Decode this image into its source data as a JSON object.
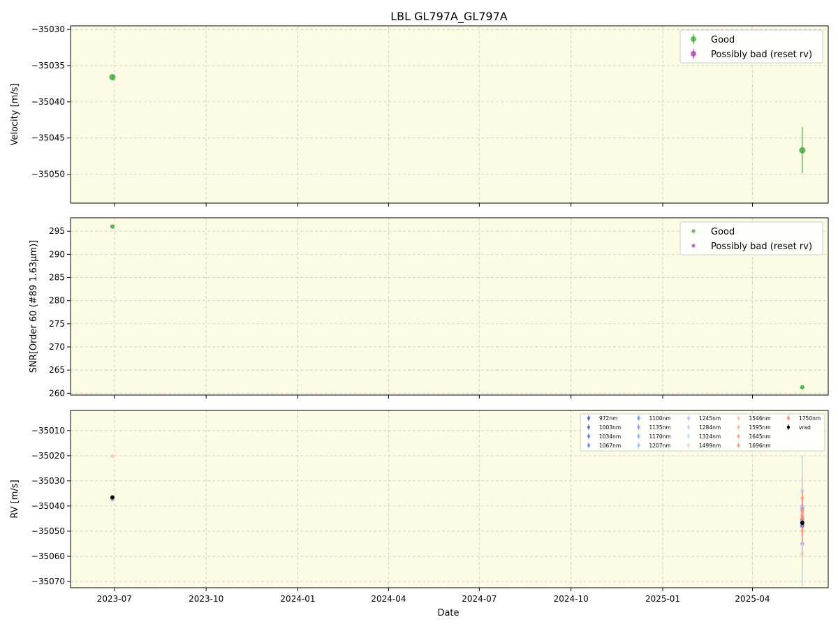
{
  "figure": {
    "title": "LBL GL797A_GL797A"
  },
  "chart_data": [
    {
      "type": "scatter",
      "panel": "velocity",
      "ylabel": "Velocity [m/s]",
      "xlabel": "",
      "xlim": [
        "2023-05-18",
        "2025-06-16"
      ],
      "ylim": [
        -35054,
        -35029.5
      ],
      "yticks": [
        -35030,
        -35035,
        -35040,
        -35045,
        -35050
      ],
      "ytick_labels": [
        "−35030",
        "−35035",
        "−35040",
        "−35045",
        "−35050"
      ],
      "grid": true,
      "legend_position": "top-right",
      "series": [
        {
          "name": "Good",
          "color": "#2ca02c",
          "marker": "errorbar",
          "points": [
            {
              "x": "2023-06-29",
              "y": -35036.6,
              "err": 0.3
            },
            {
              "x": "2025-05-21",
              "y": -35046.7,
              "err": 3.2
            }
          ]
        },
        {
          "name": "Possibly bad (reset rv)",
          "color": "#9b2f9b",
          "marker": "errorbar",
          "points": []
        }
      ]
    },
    {
      "type": "scatter",
      "panel": "snr",
      "ylabel": "SNR[Order 60 (#89 1.63µm)]",
      "xlabel": "",
      "xlim": [
        "2023-05-18",
        "2025-06-16"
      ],
      "ylim": [
        259.6,
        297.9
      ],
      "yticks": [
        295,
        290,
        285,
        280,
        275,
        270,
        265,
        260
      ],
      "ytick_labels": [
        "295",
        "290",
        "285",
        "280",
        "275",
        "270",
        "265",
        "260"
      ],
      "grid": true,
      "legend_position": "top-right",
      "series": [
        {
          "name": "Good",
          "color": "#2ca02c",
          "marker": "dot",
          "points": [
            {
              "x": "2023-06-29",
              "y": 296.0
            },
            {
              "x": "2025-05-21",
              "y": 261.3
            }
          ]
        },
        {
          "name": "Possibly bad (reset rv)",
          "color": "#9b2f9b",
          "marker": "dot",
          "points": []
        }
      ]
    },
    {
      "type": "scatter",
      "panel": "rv",
      "ylabel": "RV [m/s]",
      "xlabel": "Date",
      "xlim": [
        "2023-05-18",
        "2025-06-16"
      ],
      "ylim": [
        -35072.5,
        -35002
      ],
      "yticks": [
        -35010,
        -35020,
        -35030,
        -35040,
        -35050,
        -35060,
        -35070
      ],
      "ytick_labels": [
        "−35010",
        "−35020",
        "−35030",
        "−35040",
        "−35050",
        "−35060",
        "−35070"
      ],
      "xticks": [
        "2023-07-01",
        "2023-10-01",
        "2024-01-01",
        "2024-04-01",
        "2024-07-01",
        "2024-10-01",
        "2025-01-01",
        "2025-04-01"
      ],
      "xtick_labels": [
        "2023-07",
        "2023-10",
        "2024-01",
        "2024-04",
        "2024-07",
        "2024-10",
        "2025-01",
        "2025-04"
      ],
      "grid": true,
      "legend_position": "top-right",
      "legend_columns": 5,
      "series": [
        {
          "name": "972nm",
          "color": "#3b4cc0",
          "points": [
            {
              "x": "2023-06-29",
              "y": -35036.5,
              "err": 0.5
            },
            {
              "x": "2025-05-21",
              "y": -35047.5,
              "err": 4
            }
          ]
        },
        {
          "name": "1003nm",
          "color": "#4358cb",
          "points": [
            {
              "x": "2023-06-29",
              "y": -35036.8,
              "err": 0.5
            },
            {
              "x": "2025-05-21",
              "y": -35046.5,
              "err": 4
            }
          ]
        },
        {
          "name": "1034nm",
          "color": "#4f69d9",
          "points": [
            {
              "x": "2023-06-29",
              "y": -35037.0,
              "err": 0.5
            },
            {
              "x": "2025-05-21",
              "y": -35048.0,
              "err": 4
            }
          ]
        },
        {
          "name": "1067nm",
          "color": "#5b7ae5",
          "points": [
            {
              "x": "2023-06-29",
              "y": -35036.7,
              "err": 0.5
            },
            {
              "x": "2025-05-21",
              "y": -35045.5,
              "err": 4
            }
          ]
        },
        {
          "name": "1100nm",
          "color": "#6889ee",
          "points": [
            {
              "x": "2023-06-29",
              "y": -35037.1,
              "err": 0.5
            },
            {
              "x": "2025-05-21",
              "y": -35041.0,
              "err": 5
            }
          ]
        },
        {
          "name": "1135nm",
          "color": "#7699f6",
          "points": [
            {
              "x": "2023-06-29",
              "y": -35036.9,
              "err": 0.5
            },
            {
              "x": "2025-05-21",
              "y": -35047.0,
              "err": 5
            }
          ]
        },
        {
          "name": "1170nm",
          "color": "#84a7fc",
          "points": [
            {
              "x": "2023-06-29",
              "y": -35037.2,
              "err": 0.5
            },
            {
              "x": "2025-05-21",
              "y": -35055.0,
              "err": 6
            }
          ]
        },
        {
          "name": "1207nm",
          "color": "#93b5fe",
          "points": [
            {
              "x": "2023-06-29",
              "y": -35036.4,
              "err": 0.5
            },
            {
              "x": "2025-05-21",
              "y": -35046.0,
              "err": 26
            }
          ]
        },
        {
          "name": "1245nm",
          "color": "#a3c2fe",
          "points": [
            {
              "x": "2023-06-29",
              "y": -35037.3,
              "err": 0.5
            },
            {
              "x": "2025-05-21",
              "y": -35040.0,
              "err": 6
            }
          ]
        },
        {
          "name": "1284nm",
          "color": "#b2ccfb",
          "points": [
            {
              "x": "2023-06-29",
              "y": -35037.5,
              "err": 0.5
            },
            {
              "x": "2025-05-21",
              "y": -35043.0,
              "err": 6
            }
          ]
        },
        {
          "name": "1324nm",
          "color": "#c0d4f5",
          "points": [
            {
              "x": "2023-06-29",
              "y": -35036.9,
              "err": 0.5
            },
            {
              "x": "2025-05-21",
              "y": -35034.0,
              "err": 8
            }
          ]
        },
        {
          "name": "1499nm",
          "color": "#f2cbb7",
          "points": [
            {
              "x": "2023-06-29",
              "y": -35020.2,
              "err": 0.5
            },
            {
              "x": "2025-05-21",
              "y": -35059.0,
              "err": 6
            }
          ]
        },
        {
          "name": "1546nm",
          "color": "#f5c0a7",
          "points": [
            {
              "x": "2023-06-29",
              "y": -35037.1,
              "err": 0.5
            },
            {
              "x": "2025-05-21",
              "y": -35050.0,
              "err": 8
            }
          ]
        },
        {
          "name": "1595nm",
          "color": "#f7b396",
          "points": [
            {
              "x": "2023-06-29",
              "y": -35036.8,
              "err": 0.5
            },
            {
              "x": "2025-05-21",
              "y": -35037.0,
              "err": 9
            }
          ]
        },
        {
          "name": "1645nm",
          "color": "#f6a385",
          "points": [
            {
              "x": "2023-06-29",
              "y": -35036.6,
              "err": 0.5
            },
            {
              "x": "2025-05-21",
              "y": -35044.0,
              "err": 10
            }
          ]
        },
        {
          "name": "1696nm",
          "color": "#f39475",
          "points": [
            {
              "x": "2023-06-29",
              "y": -35037.0,
              "err": 0.5
            },
            {
              "x": "2025-05-21",
              "y": -35042.0,
              "err": 8
            }
          ]
        },
        {
          "name": "1750nm",
          "color": "#ee8468",
          "points": [
            {
              "x": "2023-06-29",
              "y": -35036.7,
              "err": 0.5
            },
            {
              "x": "2025-05-21",
              "y": -35045.0,
              "err": 9
            }
          ]
        },
        {
          "name": "vrad",
          "color": "#000000",
          "points": [
            {
              "x": "2023-06-29",
              "y": -35036.6,
              "err": 0.3
            },
            {
              "x": "2025-05-21",
              "y": -35046.7,
              "err": 1.0
            }
          ]
        }
      ]
    }
  ]
}
